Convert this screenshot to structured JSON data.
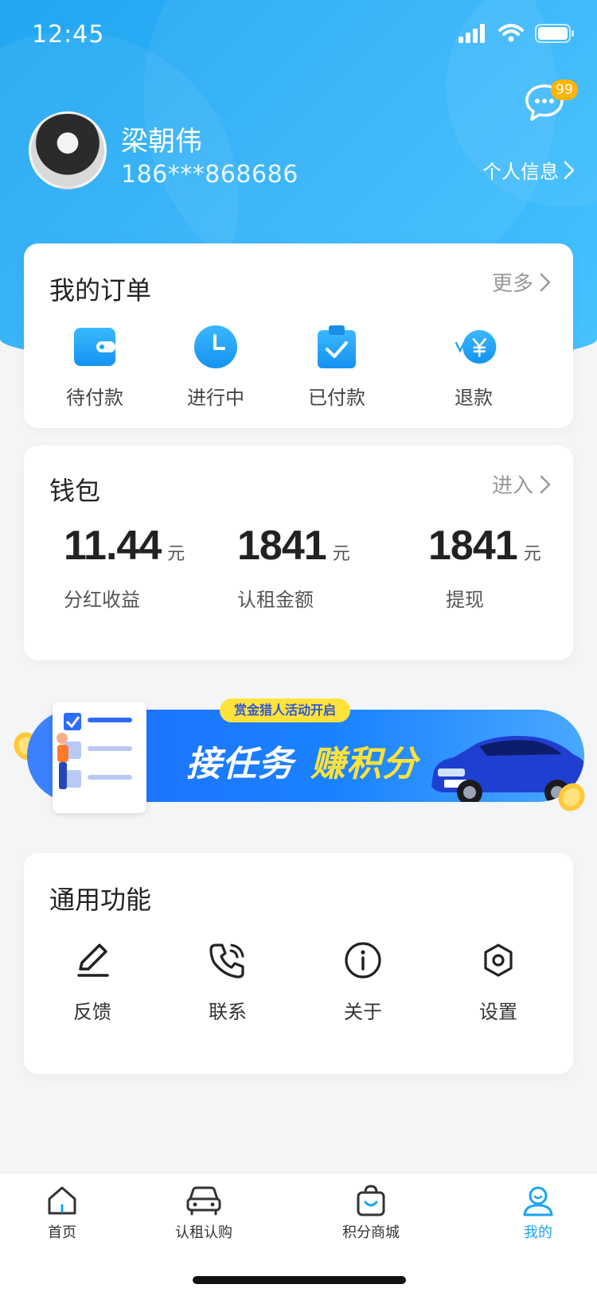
{
  "status_bar": {
    "time": "12:45"
  },
  "header": {
    "message_badge": "99",
    "user_name": "梁朝伟",
    "user_phone": "186***868686",
    "profile_link": "个人信息"
  },
  "orders": {
    "title": "我的订单",
    "more": "更多",
    "items": [
      {
        "label": "待付款",
        "icon": "wallet-icon"
      },
      {
        "label": "进行中",
        "icon": "clock-icon"
      },
      {
        "label": "已付款",
        "icon": "clipboard-check-icon"
      },
      {
        "label": "退款",
        "icon": "refund-yen-icon"
      }
    ]
  },
  "wallet": {
    "title": "钱包",
    "enter": "进入",
    "items": [
      {
        "value": "11.44",
        "unit": "元",
        "label": "分红收益"
      },
      {
        "value": "1841",
        "unit": "元",
        "label": "认租金额"
      },
      {
        "value": "1841",
        "unit": "元",
        "label": "提现"
      }
    ]
  },
  "banner": {
    "tag": "赏金猎人活动开启",
    "text_primary": "接任务",
    "text_highlight": "赚积分"
  },
  "functions": {
    "title": "通用功能",
    "items": [
      {
        "label": "反馈",
        "icon": "edit-icon"
      },
      {
        "label": "联系",
        "icon": "phone-icon"
      },
      {
        "label": "关于",
        "icon": "info-icon"
      },
      {
        "label": "设置",
        "icon": "settings-icon"
      }
    ]
  },
  "tab_bar": {
    "active": "我的",
    "tabs": [
      {
        "label": "首页",
        "icon": "home-icon"
      },
      {
        "label": "认租认购",
        "icon": "car-icon"
      },
      {
        "label": "积分商城",
        "icon": "shopping-bag-icon"
      },
      {
        "label": "我的",
        "icon": "user-icon"
      }
    ]
  },
  "colors": {
    "primary": "#1aa4f2",
    "badge": "#ffb400",
    "banner_highlight": "#ffe23a"
  }
}
